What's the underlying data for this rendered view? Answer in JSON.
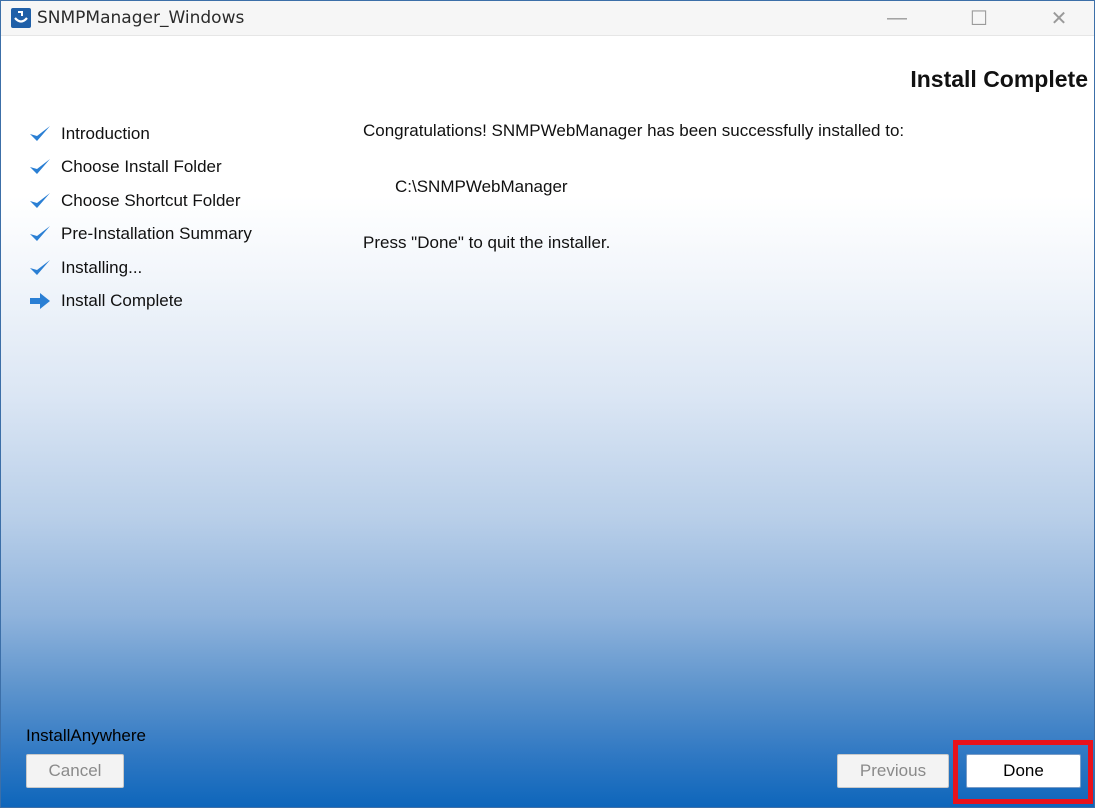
{
  "window": {
    "title": "SNMPManager_Windows",
    "controls": {
      "minimize": "—",
      "maximize": "☐",
      "close": "✕"
    }
  },
  "header": {
    "title": "Install Complete"
  },
  "steps": [
    {
      "label": "Introduction",
      "icon": "checkmark-icon",
      "status": "done"
    },
    {
      "label": "Choose Install Folder",
      "icon": "checkmark-icon",
      "status": "done"
    },
    {
      "label": "Choose Shortcut Folder",
      "icon": "checkmark-icon",
      "status": "done"
    },
    {
      "label": "Pre-Installation Summary",
      "icon": "checkmark-icon",
      "status": "done"
    },
    {
      "label": "Installing...",
      "icon": "checkmark-icon",
      "status": "done"
    },
    {
      "label": "Install Complete",
      "icon": "arrow-right-icon",
      "status": "current"
    }
  ],
  "content": {
    "message": "Congratulations! SNMPWebManager has been successfully installed to:",
    "install_path": "C:\\SNMPWebManager",
    "instruction": "Press \"Done\" to quit the installer."
  },
  "footer": {
    "brand": "InstallAnywhere",
    "cancel_label": "Cancel",
    "previous_label": "Previous",
    "done_label": "Done"
  },
  "colors": {
    "check": "#2a7fd4",
    "highlight": "#e8121b",
    "gradient_bottom": "#0e66bb"
  }
}
